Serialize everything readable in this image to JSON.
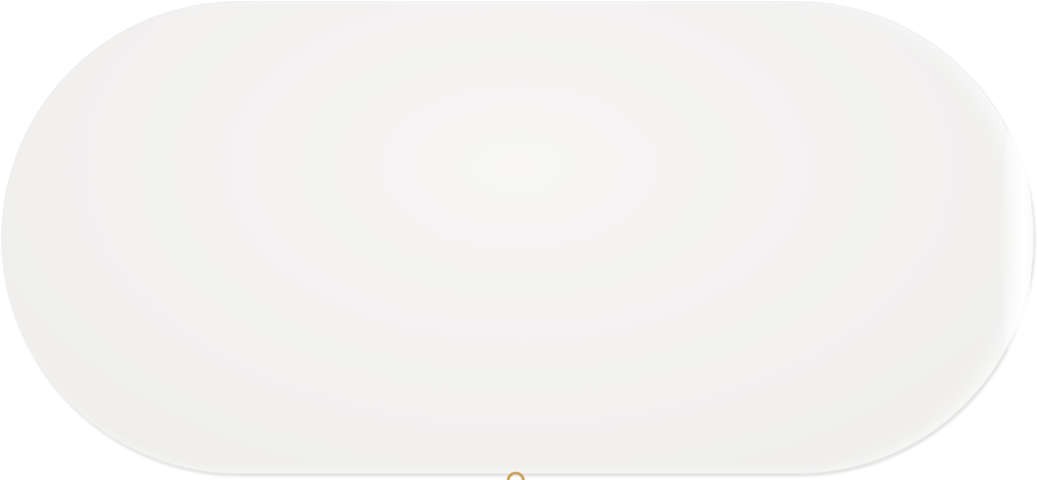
{
  "image": {
    "subject": "",
    "colors": {
      "background": "#ffffff",
      "tabletop": "#f2f1f0",
      "edge": "#ecebea",
      "leg": "#c9a15a"
    }
  }
}
